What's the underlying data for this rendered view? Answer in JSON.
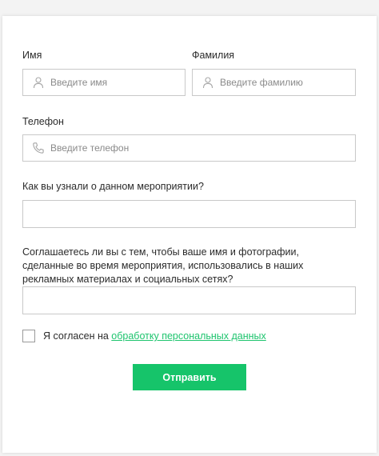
{
  "form": {
    "first_name": {
      "label": "Имя",
      "placeholder": "Введите имя",
      "icon": "user-icon"
    },
    "last_name": {
      "label": "Фамилия",
      "placeholder": "Введите фамилию",
      "icon": "user-icon"
    },
    "phone": {
      "label": "Телефон",
      "placeholder": "Введите телефон",
      "icon": "phone-icon"
    },
    "source": {
      "label": "Как вы узнали о данном мероприятии?"
    },
    "photo_consent": {
      "label": "Соглашаетесь ли вы с тем, чтобы ваше имя и фотографии, сделанные во время мероприятия, использовались в наших рекламных материалах и социальных сетях?"
    },
    "agreement": {
      "text": "Я согласен на",
      "link": "обработку персональных данных"
    },
    "submit_label": "Отправить"
  },
  "colors": {
    "accent": "#16c46a",
    "link": "#1ec46e",
    "border": "#c9c9c9"
  }
}
